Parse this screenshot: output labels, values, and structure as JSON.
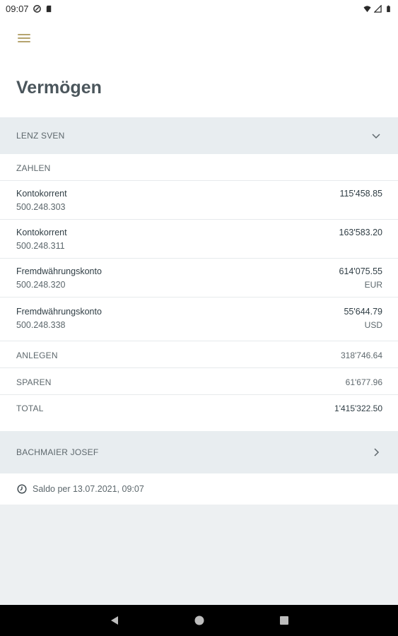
{
  "status_bar": {
    "time": "09:07"
  },
  "header": {
    "title": "Vermögen"
  },
  "clients": [
    {
      "name": "LENZ SVEN",
      "expanded": true,
      "section_label": "ZAHLEN",
      "accounts": [
        {
          "type": "Kontokorrent",
          "number": "500.248.303",
          "balance": "115'458.85",
          "currency": ""
        },
        {
          "type": "Kontokorrent",
          "number": "500.248.311",
          "balance": "163'583.20",
          "currency": ""
        },
        {
          "type": "Fremdwährungskonto",
          "number": "500.248.320",
          "balance": "614'075.55",
          "currency": "EUR"
        },
        {
          "type": "Fremdwährungskonto",
          "number": "500.248.338",
          "balance": "55'644.79",
          "currency": "USD"
        }
      ],
      "summary": [
        {
          "label": "ANLEGEN",
          "value": "318'746.64"
        },
        {
          "label": "SPAREN",
          "value": "61'677.96"
        },
        {
          "label": "TOTAL",
          "value": "1'415'322.50"
        }
      ]
    },
    {
      "name": "BACHMAIER JOSEF",
      "expanded": false
    }
  ],
  "footer": {
    "balance_note": "Saldo per 13.07.2021, 09:07"
  },
  "icons": {
    "menu": "hamburger-icon",
    "expand": "chevron-down-icon",
    "collapse": "chevron-right-icon",
    "clock": "clock-icon",
    "back": "nav-back-icon",
    "home": "nav-home-icon",
    "recents": "nav-recents-icon"
  },
  "colors": {
    "accent": "#b5a46f",
    "header_bg": "#e8edf0",
    "page_bg": "#edf0f2"
  }
}
